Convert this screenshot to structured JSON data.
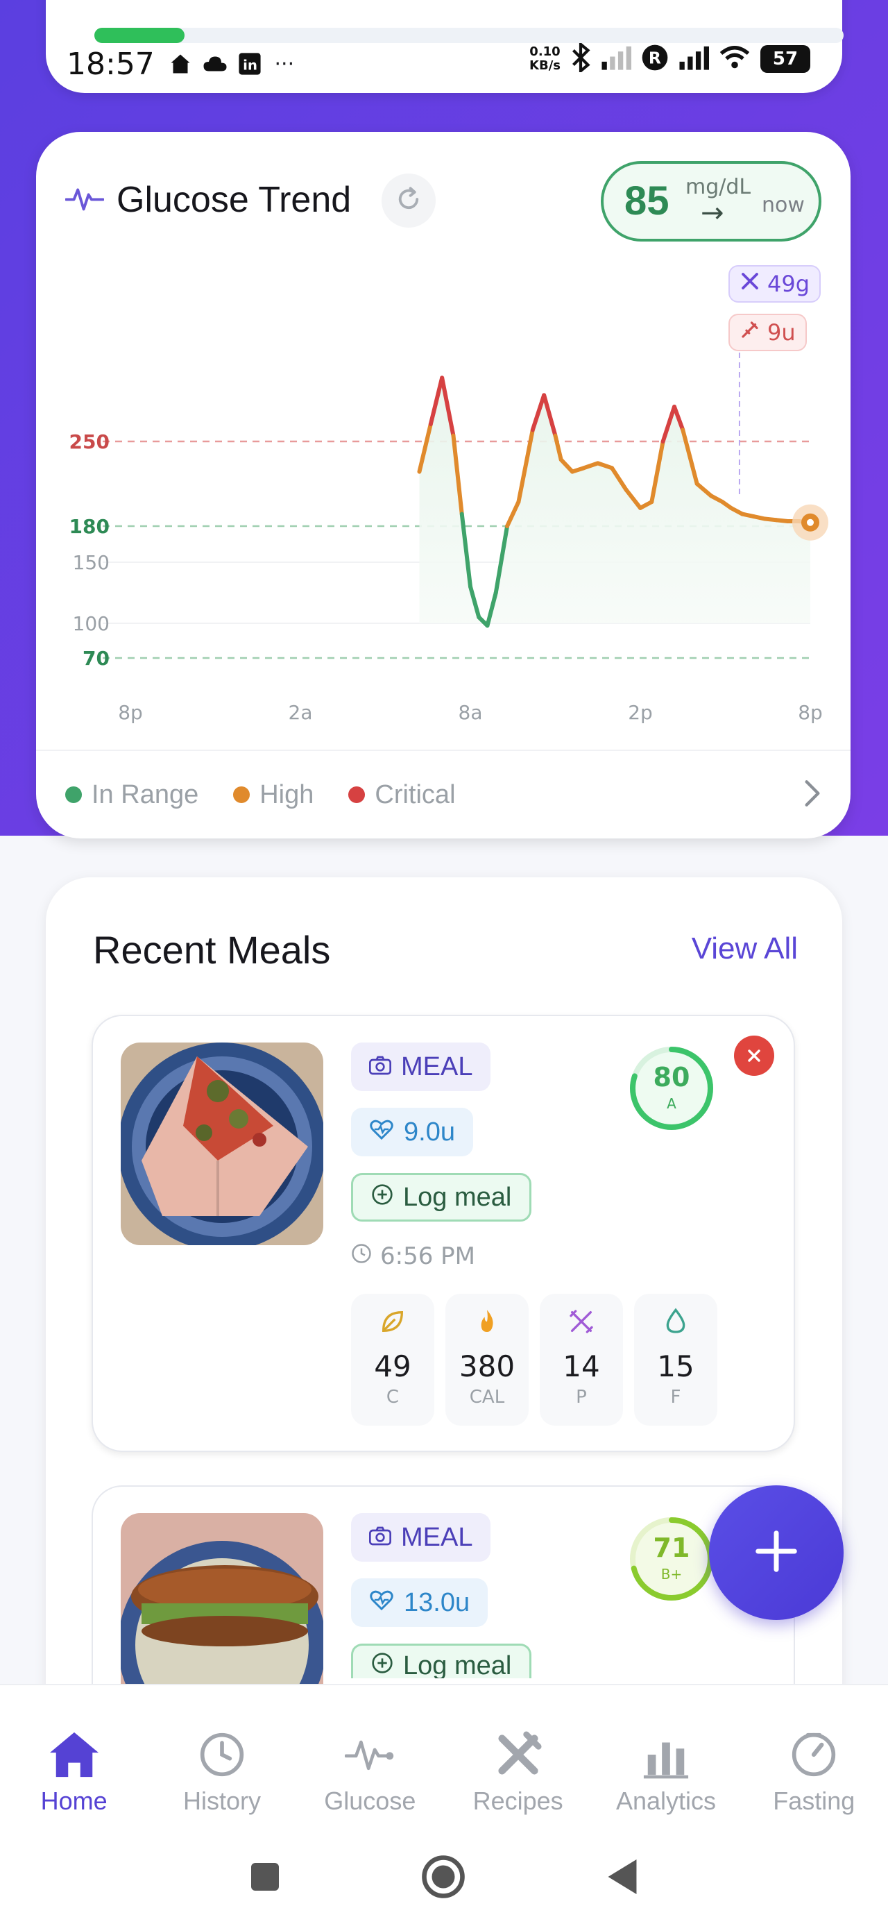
{
  "status_bar": {
    "time": "18:57",
    "net_speed_value": "0.10",
    "net_speed_unit": "KB/s",
    "battery": "57",
    "more": "···"
  },
  "glucose": {
    "title": "Glucose Trend",
    "current_value": "85",
    "current_unit": "mg/dL",
    "trend_arrow": "→",
    "current_time": "now",
    "carb_tag": "49g",
    "insulin_tag": "9u",
    "legend": [
      {
        "label": "In Range",
        "color": "#3fa36a"
      },
      {
        "label": "High",
        "color": "#e08a2c"
      },
      {
        "label": "Critical",
        "color": "#d64141"
      }
    ]
  },
  "chart_data": {
    "type": "line",
    "title": "Glucose Trend",
    "x_tick_labels": [
      "8p",
      "2a",
      "8a",
      "2p",
      "8p"
    ],
    "y_tick_labels": [
      "250",
      "180",
      "150",
      "100",
      "70"
    ],
    "reference_lines": [
      250,
      180,
      70
    ],
    "xlim_hours": [
      0,
      24
    ],
    "ylim": [
      40,
      330
    ],
    "series": [
      {
        "x": [
          10.2,
          10.6,
          11.0,
          11.4,
          11.7,
          12.0,
          12.3,
          12.6,
          12.9,
          13.3,
          13.7,
          14.2,
          14.6,
          15.0,
          15.2,
          15.6,
          16.0,
          16.5,
          17.0,
          17.5,
          18.0,
          18.4,
          18.8,
          19.2,
          19.5,
          20.0,
          20.5,
          20.9,
          21.2,
          21.6,
          22.0,
          22.4,
          22.8,
          23.2,
          23.6,
          24.0
        ],
        "y": [
          225,
          265,
          305,
          255,
          190,
          130,
          105,
          98,
          125,
          180,
          200,
          260,
          290,
          255,
          235,
          225,
          228,
          232,
          228,
          210,
          195,
          200,
          250,
          280,
          260,
          215,
          205,
          200,
          195,
          190,
          188,
          186,
          185,
          184,
          184,
          183
        ]
      }
    ],
    "meal_marker": {
      "x_hour": 21.5,
      "carbs": "49g",
      "insulin": "9u"
    }
  },
  "meals": {
    "title": "Recent Meals",
    "view_all": "View All",
    "items": [
      {
        "type_label": "MEAL",
        "insulin": "9.0u",
        "log_label": "Log meal",
        "time": "6:56 PM",
        "score": "80",
        "grade": "A",
        "score_fraction": 0.8,
        "score_color": "#3cc46a",
        "macros": [
          {
            "value": "49",
            "label": "C",
            "icon": "leaf-icon"
          },
          {
            "value": "380",
            "label": "CAL",
            "icon": "flame-icon"
          },
          {
            "value": "14",
            "label": "P",
            "icon": "utensils-icon"
          },
          {
            "value": "15",
            "label": "F",
            "icon": "droplet-icon"
          }
        ]
      },
      {
        "type_label": "MEAL",
        "insulin": "13.0u",
        "log_label": "Log meal",
        "score": "71",
        "grade": "B+",
        "score_fraction": 0.71,
        "score_color": "#8acb2e"
      }
    ]
  },
  "nav": {
    "items": [
      {
        "label": "Home",
        "icon": "home-icon",
        "active": true
      },
      {
        "label": "History",
        "icon": "clock-icon"
      },
      {
        "label": "Glucose",
        "icon": "pulse-icon"
      },
      {
        "label": "Recipes",
        "icon": "utensils-icon"
      },
      {
        "label": "Analytics",
        "icon": "bar-chart-icon"
      },
      {
        "label": "Fasting",
        "icon": "gauge-icon"
      }
    ]
  },
  "colors": {
    "accent": "#5542d4",
    "in_range": "#3fa36a",
    "high": "#e08a2c",
    "critical": "#d64141"
  }
}
